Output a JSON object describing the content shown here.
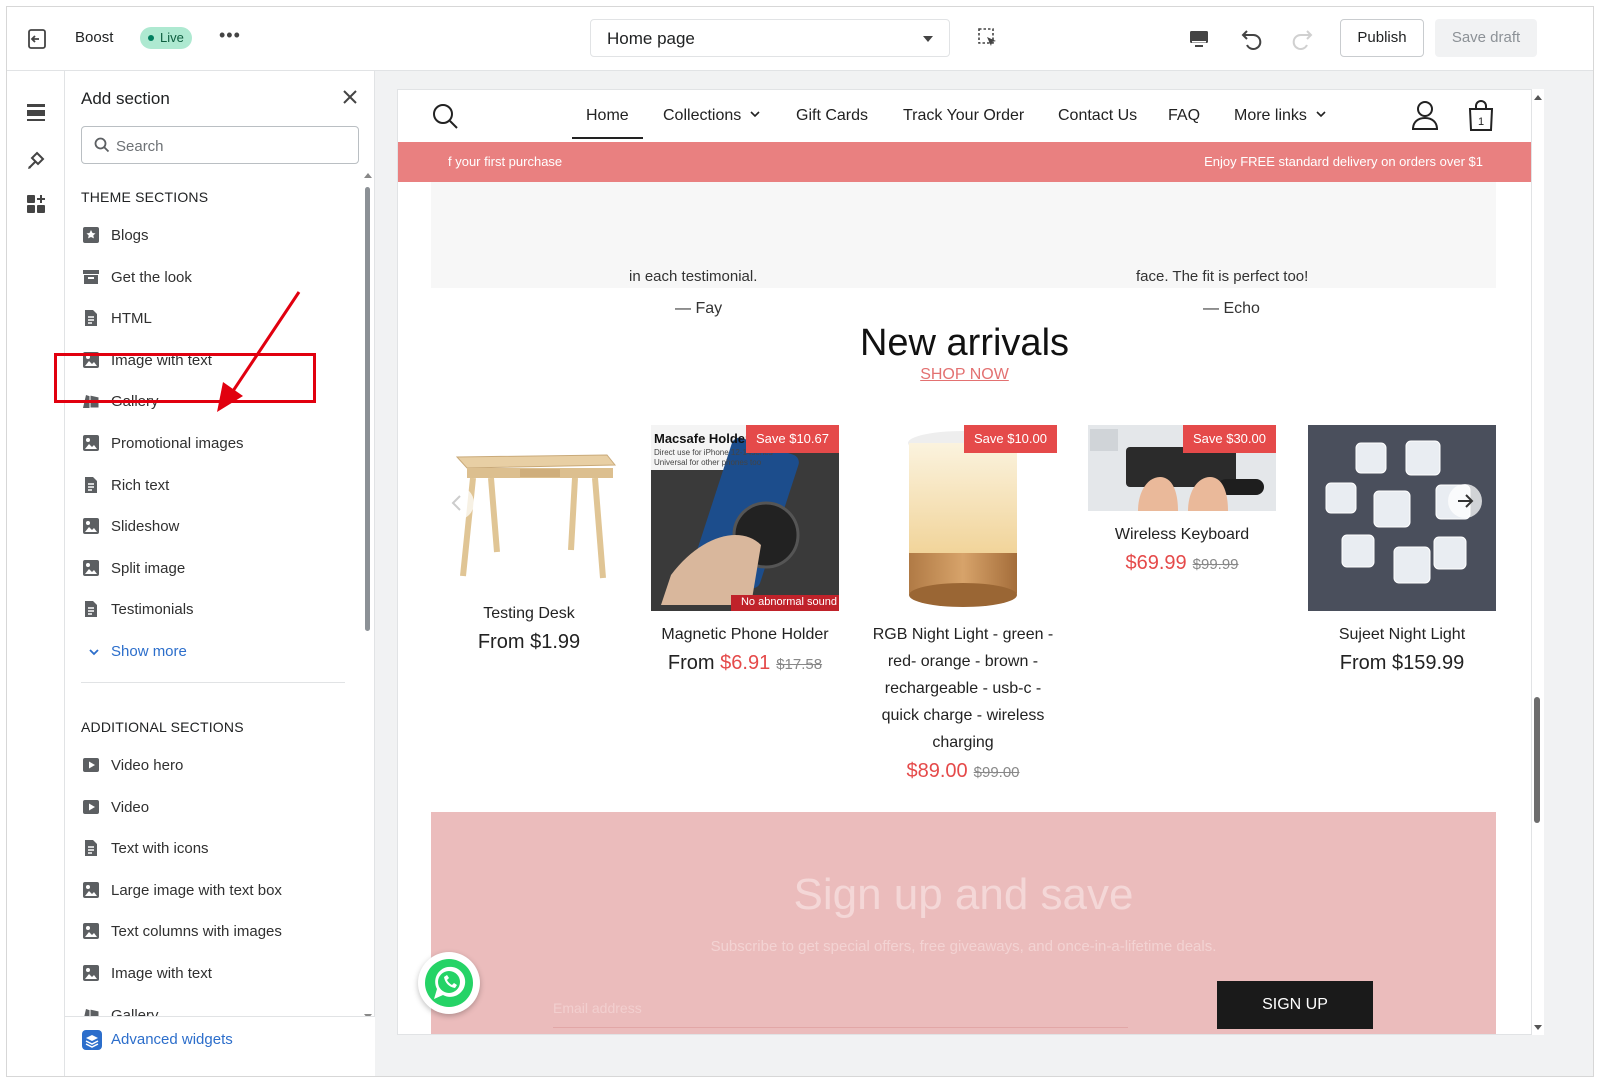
{
  "topbar": {
    "store_name": "Boost",
    "live_badge": "Live",
    "more_label": "•••",
    "page_selector": "Home page",
    "publish_label": "Publish",
    "save_draft_label": "Save draft"
  },
  "panel": {
    "title": "Add section",
    "search_placeholder": "Search",
    "theme_heading": "THEME SECTIONS",
    "theme_items": [
      {
        "label": "Blogs",
        "icon": "bookmark-icon"
      },
      {
        "label": "Get the look",
        "icon": "archive-icon"
      },
      {
        "label": "HTML",
        "icon": "document-icon"
      },
      {
        "label": "Image with text",
        "icon": "image-icon"
      },
      {
        "label": "Gallery",
        "icon": "gallery-icon"
      },
      {
        "label": "Promotional images",
        "icon": "image-icon"
      },
      {
        "label": "Rich text",
        "icon": "document-icon"
      },
      {
        "label": "Slideshow",
        "icon": "image-icon"
      },
      {
        "label": "Split image",
        "icon": "image-icon"
      },
      {
        "label": "Testimonials",
        "icon": "document-icon"
      }
    ],
    "show_more": "Show more",
    "additional_heading": "ADDITIONAL SECTIONS",
    "additional_items": [
      {
        "label": "Video hero",
        "icon": "play-icon"
      },
      {
        "label": "Video",
        "icon": "play-icon"
      },
      {
        "label": "Text with icons",
        "icon": "document-icon"
      },
      {
        "label": "Large image with text box",
        "icon": "image-icon"
      },
      {
        "label": "Text columns with images",
        "icon": "image-icon"
      },
      {
        "label": "Image with text",
        "icon": "image-icon"
      },
      {
        "label": "Gallery",
        "icon": "gallery-icon"
      }
    ],
    "advanced_widgets": "Advanced widgets"
  },
  "store": {
    "nav": [
      {
        "label": "Home",
        "active": true
      },
      {
        "label": "Collections",
        "dropdown": true
      },
      {
        "label": "Gift Cards"
      },
      {
        "label": "Track Your Order"
      },
      {
        "label": "Contact Us"
      },
      {
        "label": "FAQ"
      },
      {
        "label": "More links",
        "dropdown": true
      }
    ],
    "announcement_left": "f your first purchase",
    "announcement_right": "Enjoy FREE standard delivery on orders over $1",
    "testimonials": [
      {
        "quote": "in each testimonial.",
        "author": "— Fay"
      },
      {
        "quote": "face. The fit is perfect too!",
        "author": "— Echo"
      }
    ],
    "new_arrivals": {
      "title": "New arrivals",
      "link": "SHOP NOW",
      "products": [
        {
          "name": "Testing Desk",
          "prefix": "From",
          "price": "$1.99",
          "compare": "",
          "badge": "",
          "on_sale": false
        },
        {
          "name": "Magnetic Phone Holder",
          "prefix": "From",
          "price": "$6.91",
          "compare": "$17.58",
          "badge": "Save $10.67",
          "on_sale": true,
          "img_title": "Macsafe Holder",
          "img_sub1": "Direct use for iPhone 12-14series",
          "img_sub2": "Universal for other phones too",
          "img_note": "No abnormal sound"
        },
        {
          "name": "RGB Night Light - green - red- orange - brown - rechargeable - usb-c - quick charge - wireless charging",
          "prefix": "",
          "price": "$89.00",
          "compare": "$99.00",
          "badge": "Save $10.00",
          "on_sale": true
        },
        {
          "name": "Wireless Keyboard",
          "prefix": "",
          "price": "$69.99",
          "compare": "$99.99",
          "badge": "Save $30.00",
          "on_sale": true
        },
        {
          "name": "Sujeet Night Light",
          "prefix": "From",
          "price": "$159.99",
          "compare": "",
          "badge": "",
          "on_sale": false
        }
      ]
    },
    "signup": {
      "title": "Sign up and save",
      "subtitle": "Subscribe to get special offers, free giveaways, and once-in-a-lifetime deals.",
      "email_placeholder": "Email address",
      "button": "SIGN UP"
    }
  },
  "colors": {
    "announcement_bg": "#e98080",
    "sale_red": "#e54a4a",
    "signup_bg": "#ebbcbc",
    "highlight_red": "#e1000f",
    "link_blue": "#2c6ecb"
  }
}
